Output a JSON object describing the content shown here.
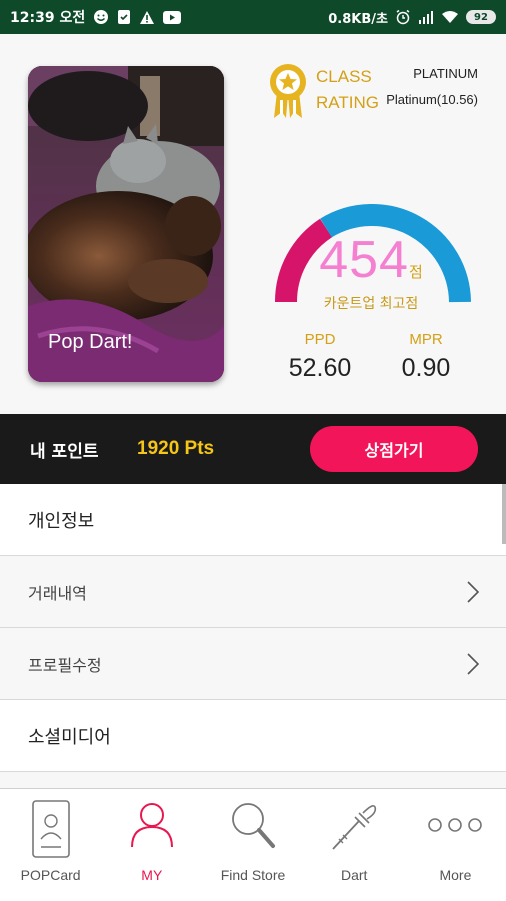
{
  "status_bar": {
    "time": "12:39 오전",
    "network_speed": "0.8KB/초",
    "battery": "92",
    "icons": [
      "face-icon",
      "shield-icon",
      "warning-icon",
      "youtube-icon",
      "alarm-icon",
      "signal-icon",
      "wifi-icon",
      "battery-icon"
    ]
  },
  "profile": {
    "photo_caption": "Pop Dart!",
    "class_label_line1": "CLASS",
    "class_label_line2": "RATING",
    "class_value": "PLATINUM",
    "rating_value": "Platinum(10.56)",
    "score": "454",
    "score_unit": "점",
    "score_caption": "카운트업 최고점",
    "ppd_label": "PPD",
    "ppd_value": "52.60",
    "mpr_label": "MPR",
    "mpr_value": "0.90",
    "gauge_colors": {
      "left": "#d6146a",
      "right": "#1a9ad6"
    }
  },
  "points": {
    "label": "내 포인트",
    "value": "1920 Pts",
    "shop_button": "상점가기"
  },
  "menu": {
    "header": "개인정보",
    "items": [
      "거래내역",
      "프로필수정"
    ],
    "header2": "소셜미디어"
  },
  "bottom_nav": [
    {
      "label": "POPCard",
      "icon": "card-icon"
    },
    {
      "label": "MY",
      "icon": "user-icon"
    },
    {
      "label": "Find Store",
      "icon": "search-icon"
    },
    {
      "label": "Dart",
      "icon": "dart-icon"
    },
    {
      "label": "More",
      "icon": "more-icon"
    }
  ],
  "colors": {
    "accent": "#f2155a",
    "gold": "#d4a017",
    "status_bar": "#0e4a2a",
    "active_tab": "#e8174f"
  }
}
